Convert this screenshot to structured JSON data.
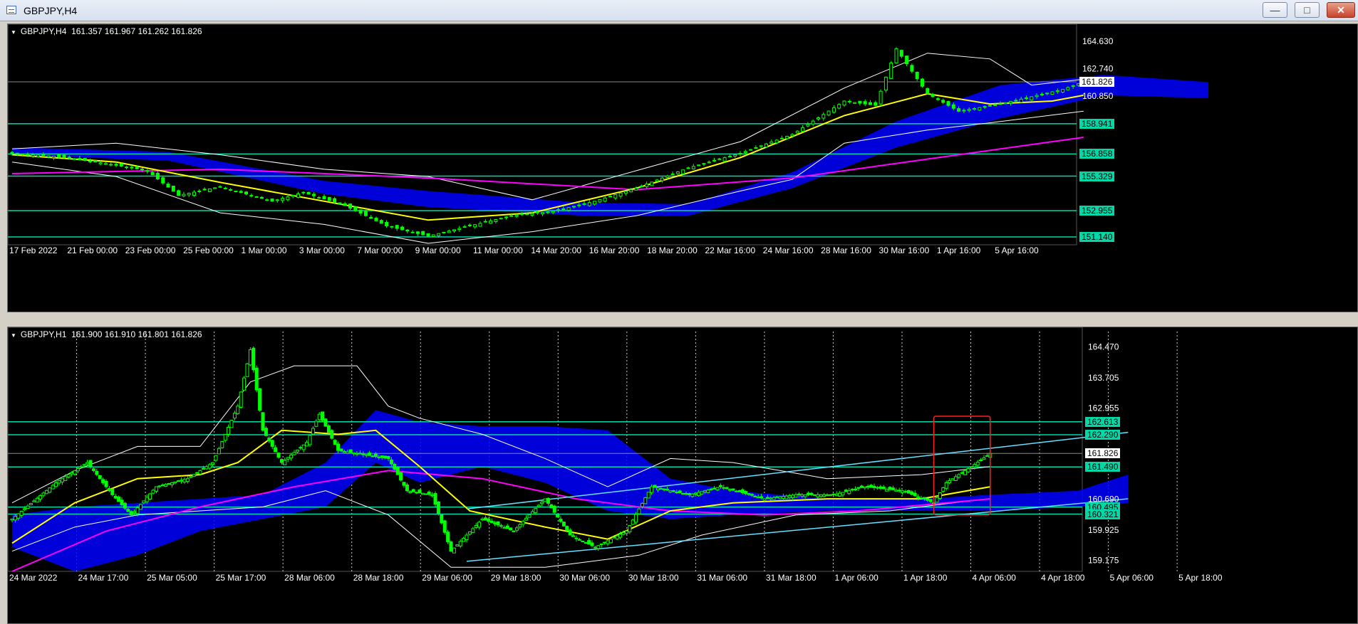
{
  "window": {
    "title": "GBPJPY,H4",
    "min_icon": "minimize-icon",
    "max_icon": "maximize-icon",
    "close_icon": "close-icon"
  },
  "colors": {
    "background": "#000000",
    "grid": "#ffffff",
    "bull": "#00ff00",
    "level": "#00d8a8",
    "trend": "#66e0ff",
    "ma_fast": "#ffff00",
    "ma_slow": "#ff00ff",
    "cloud": "#0000ff",
    "bands": "#ffffff",
    "highlight": "#ff2020"
  },
  "chart_data": [
    {
      "type": "candlestick",
      "symbol": "GBPJPY,H4",
      "header": "GBPJPY,H4  161.357 161.967 161.262 161.826",
      "ylim": [
        150.6,
        165.5
      ],
      "x_labels": [
        "17 Feb 2022",
        "21 Feb 00:00",
        "23 Feb 00:00",
        "25 Feb 00:00",
        "1 Mar 00:00",
        "3 Mar 00:00",
        "7 Mar 00:00",
        "9 Mar 00:00",
        "11 Mar 00:00",
        "14 Mar 20:00",
        "16 Mar 20:00",
        "18 Mar 20:00",
        "22 Mar 16:00",
        "24 Mar 16:00",
        "28 Mar 16:00",
        "30 Mar 16:00",
        "1 Apr 16:00",
        "5 Apr 16:00"
      ],
      "y_ticks": [
        151.14,
        152.955,
        155.32,
        156.858,
        158.941,
        160.85,
        162.74,
        164.63
      ],
      "y_ticks_visible": [
        "164.630",
        "162.740",
        "160.850"
      ],
      "levels": [
        158.941,
        156.858,
        155.329,
        152.955,
        151.14
      ],
      "level_labels": [
        "158.941",
        "156.858",
        "155.329",
        "152.955",
        "151.140"
      ],
      "current_price": 161.826,
      "current_label": "161.826",
      "n_candles": 180,
      "path": [
        [
          0,
          156.9
        ],
        [
          8,
          156.7
        ],
        [
          18,
          156.2
        ],
        [
          26,
          155.7
        ],
        [
          32,
          154.0
        ],
        [
          40,
          154.6
        ],
        [
          50,
          153.6
        ],
        [
          56,
          154.2
        ],
        [
          64,
          153.3
        ],
        [
          72,
          151.9
        ],
        [
          80,
          151.2
        ],
        [
          88,
          151.9
        ],
        [
          96,
          152.6
        ],
        [
          104,
          152.9
        ],
        [
          112,
          153.6
        ],
        [
          120,
          154.5
        ],
        [
          130,
          155.9
        ],
        [
          140,
          156.9
        ],
        [
          150,
          158.2
        ],
        [
          160,
          160.5
        ],
        [
          166,
          160.2
        ],
        [
          170,
          164.1
        ],
        [
          176,
          161.0
        ],
        [
          182,
          159.8
        ],
        [
          190,
          160.3
        ],
        [
          196,
          160.8
        ],
        [
          202,
          161.3
        ],
        [
          206,
          161.826
        ]
      ],
      "ma_fast": [
        [
          0,
          156.8
        ],
        [
          20,
          156.3
        ],
        [
          40,
          154.9
        ],
        [
          60,
          153.6
        ],
        [
          80,
          152.3
        ],
        [
          100,
          152.8
        ],
        [
          120,
          154.5
        ],
        [
          140,
          156.6
        ],
        [
          160,
          159.5
        ],
        [
          176,
          161.0
        ],
        [
          188,
          160.3
        ],
        [
          200,
          160.5
        ],
        [
          206,
          160.9
        ]
      ],
      "ma_slow": [
        [
          0,
          155.5
        ],
        [
          40,
          155.8
        ],
        [
          80,
          155.2
        ],
        [
          120,
          154.4
        ],
        [
          150,
          155.2
        ],
        [
          180,
          156.7
        ],
        [
          206,
          158.0
        ]
      ],
      "bb_upper": [
        [
          0,
          157.2
        ],
        [
          20,
          157.6
        ],
        [
          40,
          156.8
        ],
        [
          60,
          155.8
        ],
        [
          80,
          155.3
        ],
        [
          100,
          153.7
        ],
        [
          120,
          155.7
        ],
        [
          140,
          157.7
        ],
        [
          160,
          161.4
        ],
        [
          176,
          163.8
        ],
        [
          188,
          163.4
        ],
        [
          196,
          161.6
        ],
        [
          206,
          162.0
        ]
      ],
      "bb_lower": [
        [
          0,
          156.3
        ],
        [
          20,
          155.3
        ],
        [
          40,
          152.8
        ],
        [
          60,
          152.0
        ],
        [
          80,
          150.7
        ],
        [
          100,
          151.5
        ],
        [
          120,
          152.6
        ],
        [
          140,
          154.3
        ],
        [
          150,
          155.1
        ],
        [
          160,
          157.6
        ],
        [
          176,
          158.5
        ],
        [
          188,
          159.0
        ],
        [
          206,
          159.8
        ]
      ],
      "cloud_upper": [
        [
          0,
          157.3
        ],
        [
          30,
          157.0
        ],
        [
          60,
          155.0
        ],
        [
          80,
          154.3
        ],
        [
          110,
          153.5
        ],
        [
          130,
          153.4
        ],
        [
          150,
          155.6
        ],
        [
          170,
          159.1
        ],
        [
          190,
          161.6
        ],
        [
          210,
          162.3
        ],
        [
          230,
          161.8
        ]
      ],
      "cloud_lower": [
        [
          0,
          156.8
        ],
        [
          30,
          156.4
        ],
        [
          60,
          154.1
        ],
        [
          80,
          153.2
        ],
        [
          110,
          152.6
        ],
        [
          130,
          152.6
        ],
        [
          150,
          154.5
        ],
        [
          170,
          157.3
        ],
        [
          190,
          159.3
        ],
        [
          210,
          160.9
        ],
        [
          230,
          160.7
        ]
      ]
    },
    {
      "type": "candlestick",
      "symbol": "GBPJPY,H1",
      "header": "GBPJPY,H1  161.900 161.910 161.801 161.826",
      "ylim": [
        158.9,
        164.85
      ],
      "x_labels": [
        "24 Mar 2022",
        "24 Mar 17:00",
        "25 Mar 05:00",
        "25 Mar 17:00",
        "28 Mar 06:00",
        "28 Mar 18:00",
        "29 Mar 06:00",
        "29 Mar 18:00",
        "30 Mar 06:00",
        "30 Mar 18:00",
        "31 Mar 06:00",
        "31 Mar 18:00",
        "1 Apr 06:00",
        "1 Apr 18:00",
        "4 Apr 06:00",
        "4 Apr 18:00",
        "5 Apr 06:00",
        "5 Apr 18:00"
      ],
      "y_ticks": [
        159.175,
        159.925,
        160.69,
        161.49,
        162.29,
        162.955,
        163.705,
        164.47
      ],
      "y_ticks_visible": [
        "164.470",
        "163.705",
        "162.955",
        "160.690",
        "159.925",
        "159.175"
      ],
      "levels": [
        162.613,
        162.29,
        161.49,
        160.495,
        160.321
      ],
      "level_labels": [
        "162.613",
        "162.290",
        "161.490",
        "160.495",
        "160.321"
      ],
      "current_price": 161.826,
      "current_label": "161.826",
      "n_candles": 230,
      "path": [
        [
          0,
          160.2
        ],
        [
          14,
          161.1
        ],
        [
          24,
          161.6
        ],
        [
          32,
          160.8
        ],
        [
          38,
          160.3
        ],
        [
          46,
          161.0
        ],
        [
          56,
          161.2
        ],
        [
          64,
          161.6
        ],
        [
          72,
          163.0
        ],
        [
          76,
          164.4
        ],
        [
          80,
          162.4
        ],
        [
          86,
          161.6
        ],
        [
          94,
          162.1
        ],
        [
          98,
          162.8
        ],
        [
          104,
          161.9
        ],
        [
          112,
          161.8
        ],
        [
          120,
          161.7
        ],
        [
          126,
          160.9
        ],
        [
          134,
          160.8
        ],
        [
          140,
          159.4
        ],
        [
          150,
          160.2
        ],
        [
          160,
          159.9
        ],
        [
          170,
          160.7
        ],
        [
          178,
          159.8
        ],
        [
          186,
          159.5
        ],
        [
          196,
          159.9
        ],
        [
          204,
          161.0
        ],
        [
          216,
          160.8
        ],
        [
          226,
          161.0
        ],
        [
          240,
          160.7
        ],
        [
          250,
          160.8
        ],
        [
          262,
          160.8
        ],
        [
          272,
          161.0
        ],
        [
          284,
          160.9
        ],
        [
          294,
          160.6
        ],
        [
          298,
          161.1
        ],
        [
          306,
          161.5
        ],
        [
          312,
          161.826
        ]
      ],
      "ma_fast": [
        [
          0,
          159.6
        ],
        [
          20,
          160.6
        ],
        [
          40,
          161.2
        ],
        [
          60,
          161.3
        ],
        [
          72,
          161.6
        ],
        [
          86,
          162.4
        ],
        [
          104,
          162.3
        ],
        [
          116,
          162.4
        ],
        [
          130,
          161.5
        ],
        [
          146,
          160.4
        ],
        [
          170,
          160.0
        ],
        [
          190,
          159.7
        ],
        [
          210,
          160.4
        ],
        [
          230,
          160.6
        ],
        [
          260,
          160.7
        ],
        [
          290,
          160.7
        ],
        [
          312,
          161.0
        ]
      ],
      "ma_slow": [
        [
          0,
          158.9
        ],
        [
          30,
          159.9
        ],
        [
          60,
          160.5
        ],
        [
          90,
          161.0
        ],
        [
          120,
          161.4
        ],
        [
          150,
          161.2
        ],
        [
          180,
          160.7
        ],
        [
          210,
          160.4
        ],
        [
          240,
          160.3
        ],
        [
          270,
          160.4
        ],
        [
          312,
          160.7
        ]
      ],
      "bb_upper": [
        [
          0,
          160.6
        ],
        [
          20,
          161.4
        ],
        [
          40,
          162.0
        ],
        [
          60,
          162.0
        ],
        [
          76,
          163.6
        ],
        [
          90,
          164.0
        ],
        [
          110,
          164.0
        ],
        [
          120,
          163.0
        ],
        [
          130,
          162.7
        ],
        [
          150,
          162.3
        ],
        [
          170,
          161.7
        ],
        [
          190,
          161.0
        ],
        [
          210,
          161.7
        ],
        [
          230,
          161.6
        ],
        [
          260,
          161.2
        ],
        [
          290,
          161.3
        ],
        [
          312,
          161.5
        ]
      ],
      "bb_lower": [
        [
          0,
          159.4
        ],
        [
          20,
          160.0
        ],
        [
          40,
          160.3
        ],
        [
          60,
          160.4
        ],
        [
          80,
          160.5
        ],
        [
          100,
          160.9
        ],
        [
          110,
          160.6
        ],
        [
          120,
          160.3
        ],
        [
          140,
          159.0
        ],
        [
          170,
          159.0
        ],
        [
          200,
          159.3
        ],
        [
          220,
          159.8
        ],
        [
          250,
          160.3
        ],
        [
          280,
          160.4
        ],
        [
          300,
          160.6
        ],
        [
          312,
          160.7
        ]
      ],
      "cloud_upper": [
        [
          0,
          160.3
        ],
        [
          20,
          160.5
        ],
        [
          40,
          160.6
        ],
        [
          60,
          160.7
        ],
        [
          80,
          160.8
        ],
        [
          100,
          161.6
        ],
        [
          116,
          162.9
        ],
        [
          130,
          162.6
        ],
        [
          150,
          162.5
        ],
        [
          170,
          162.5
        ],
        [
          190,
          162.4
        ],
        [
          210,
          161.2
        ],
        [
          230,
          160.9
        ],
        [
          260,
          160.7
        ],
        [
          290,
          160.7
        ],
        [
          312,
          160.8
        ],
        [
          340,
          160.9
        ],
        [
          356,
          161.3
        ]
      ],
      "cloud_lower": [
        [
          0,
          159.5
        ],
        [
          20,
          158.9
        ],
        [
          40,
          159.3
        ],
        [
          60,
          159.9
        ],
        [
          80,
          160.2
        ],
        [
          100,
          160.5
        ],
        [
          116,
          161.6
        ],
        [
          130,
          161.1
        ],
        [
          150,
          161.5
        ],
        [
          170,
          161.1
        ],
        [
          190,
          160.4
        ],
        [
          210,
          160.2
        ],
        [
          230,
          160.3
        ],
        [
          260,
          160.4
        ],
        [
          290,
          160.4
        ],
        [
          312,
          160.4
        ],
        [
          340,
          160.5
        ],
        [
          356,
          160.6
        ]
      ],
      "trendlines": [
        [
          [
            145,
            160.45
          ],
          [
            356,
            162.35
          ]
        ],
        [
          [
            145,
            159.15
          ],
          [
            356,
            160.7
          ]
        ]
      ],
      "highlight_box": {
        "x0": 294,
        "x1": 312,
        "y0": 160.3,
        "y1": 162.75
      }
    }
  ]
}
